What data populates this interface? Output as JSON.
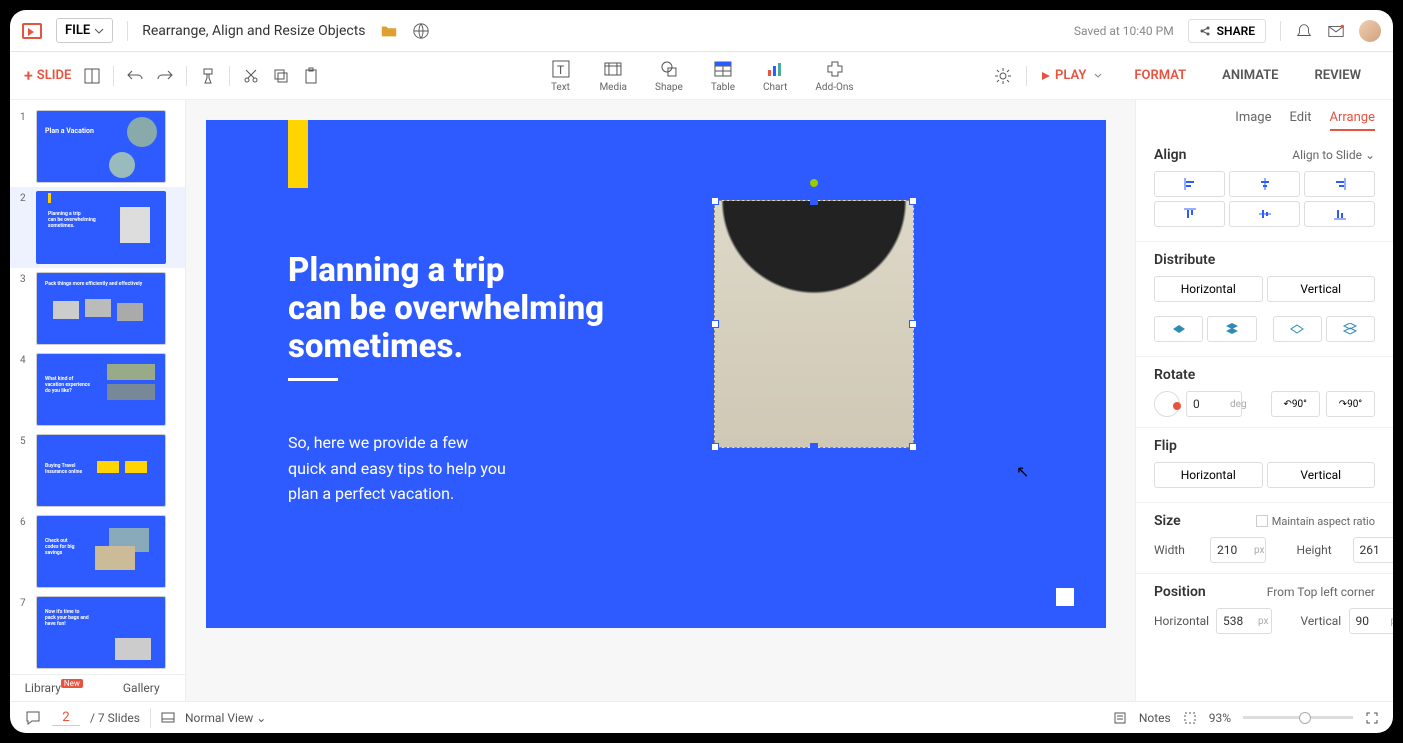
{
  "topbar": {
    "file_label": "FILE",
    "title": "Rearrange, Align and Resize Objects",
    "saved": "Saved at 10:40 PM",
    "share": "SHARE"
  },
  "toolbar": {
    "slide_label": "SLIDE",
    "insert": {
      "text": "Text",
      "media": "Media",
      "shape": "Shape",
      "table": "Table",
      "chart": "Chart",
      "addons": "Add-Ons"
    },
    "play": "PLAY",
    "tabs": {
      "format": "FORMAT",
      "animate": "ANIMATE",
      "review": "REVIEW"
    }
  },
  "slides": {
    "count": 7,
    "panel_tabs": {
      "library": "Library",
      "library_badge": "New",
      "gallery": "Gallery"
    },
    "current": 2,
    "content": {
      "heading_l1": "Planning a trip",
      "heading_l2": "can be overwhelming",
      "heading_l3": "sometimes.",
      "sub_l1": "So, here we provide a few",
      "sub_l2": "quick and easy tips to help you",
      "sub_l3": "plan a perfect vacation."
    }
  },
  "right": {
    "subtabs": {
      "image": "Image",
      "edit": "Edit",
      "arrange": "Arrange"
    },
    "align": {
      "title": "Align",
      "link": "Align to Slide"
    },
    "distribute": {
      "title": "Distribute",
      "horizontal": "Horizontal",
      "vertical": "Vertical"
    },
    "rotate": {
      "title": "Rotate",
      "value": "0",
      "unit": "deg",
      "ninety_a": "90°",
      "ninety_b": "90°"
    },
    "flip": {
      "title": "Flip",
      "horizontal": "Horizontal",
      "vertical": "Vertical"
    },
    "size": {
      "title": "Size",
      "aspect": "Maintain aspect ratio",
      "width_label": "Width",
      "width": "210",
      "height_label": "Height",
      "height": "261",
      "unit": "px"
    },
    "position": {
      "title": "Position",
      "origin": "From Top left corner",
      "h_label": "Horizontal",
      "h": "538",
      "v_label": "Vertical",
      "v": "90",
      "unit": "px"
    }
  },
  "status": {
    "current": "2",
    "total": "/ 7 Slides",
    "view": "Normal View",
    "notes": "Notes",
    "zoom": "93%"
  }
}
